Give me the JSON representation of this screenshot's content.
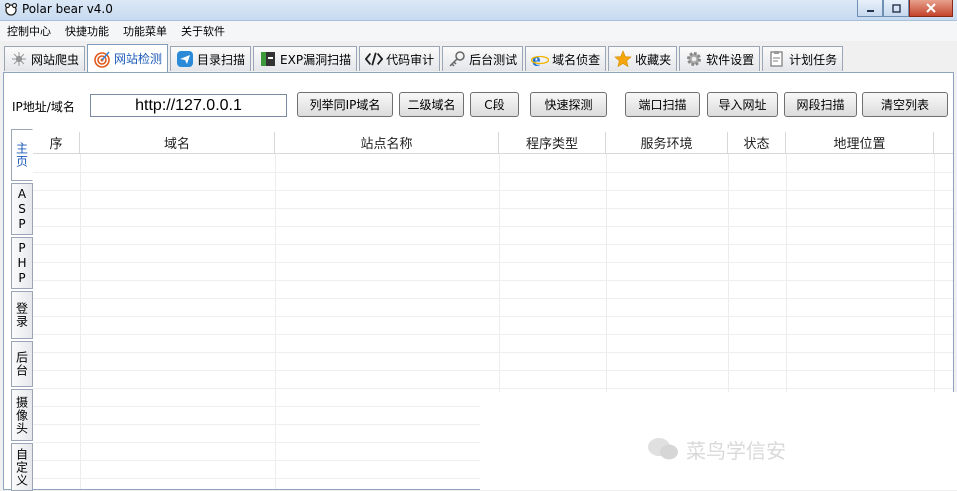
{
  "window": {
    "title": "Polar bear v4.0",
    "controls": [
      "minimize",
      "maximize",
      "close"
    ]
  },
  "menubar": {
    "items": [
      "控制中心",
      "快捷功能",
      "功能菜单",
      "关于软件"
    ]
  },
  "tabs": [
    {
      "label": "网站爬虫",
      "icon": "spider-icon",
      "active": false
    },
    {
      "label": "网站检测",
      "icon": "target-icon",
      "active": true
    },
    {
      "label": "目录扫描",
      "icon": "telegram-icon",
      "active": false
    },
    {
      "label": "EXP漏洞扫描",
      "icon": "terminal-icon",
      "active": false
    },
    {
      "label": "代码审计",
      "icon": "code-icon",
      "active": false
    },
    {
      "label": "后台测试",
      "icon": "key-icon",
      "active": false
    },
    {
      "label": "域名侦查",
      "icon": "ie-icon",
      "active": false
    },
    {
      "label": "收藏夹",
      "icon": "star-icon",
      "active": false
    },
    {
      "label": "软件设置",
      "icon": "gear-icon",
      "active": false
    },
    {
      "label": "计划任务",
      "icon": "clipboard-icon",
      "active": false
    }
  ],
  "ip_row": {
    "label": "IP地址/域名",
    "value": "http://127.0.0.1",
    "buttons": [
      "列举同IP域名",
      "二级域名",
      "C段",
      "快速探测",
      "端口扫描",
      "导入网址",
      "网段扫描",
      "清空列表"
    ]
  },
  "side_tabs": [
    {
      "label": "主页",
      "active": true
    },
    {
      "label": "ASP",
      "active": false
    },
    {
      "label": "PHP",
      "active": false
    },
    {
      "label": "登录",
      "active": false
    },
    {
      "label": "后台",
      "active": false
    },
    {
      "label": "摄像头",
      "active": false
    },
    {
      "label": "自定义",
      "active": false
    }
  ],
  "table": {
    "columns": [
      "序",
      "域名",
      "站点名称",
      "程序类型",
      "服务环境",
      "状态",
      "地理位置"
    ],
    "rows": []
  },
  "watermark": {
    "text": "菜鸟学信安"
  },
  "colors": {
    "accent": "#1c5bb8",
    "titlebar": "#c7daef",
    "close": "#c4432b"
  }
}
